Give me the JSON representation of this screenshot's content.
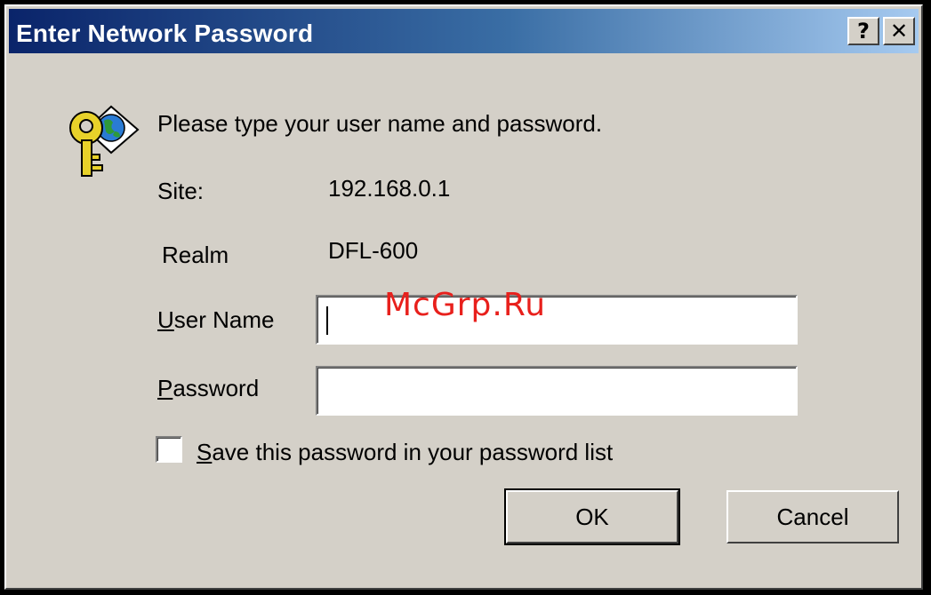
{
  "window": {
    "title": "Enter Network Password",
    "help_glyph": "?",
    "close_glyph": "✕"
  },
  "dialog": {
    "prompt": "Please type your user name and password.",
    "site_label": "Site:",
    "site_value": "192.168.0.1",
    "realm_label": "Realm",
    "realm_value": "DFL-600",
    "user_label_key": "U",
    "user_label_rest": "ser Name",
    "user_value": "",
    "password_label_key": "P",
    "password_label_rest": "assword",
    "password_value": "",
    "save_label_key": "S",
    "save_label_rest": "ave this password in your password list",
    "save_checked": false,
    "ok_label": "OK",
    "cancel_label": "Cancel"
  },
  "watermark": "McGrp.Ru",
  "icons": {
    "dialog_icon": "key-globe-icon"
  },
  "colors": {
    "title_start": "#0a246a",
    "title_end": "#a6caf0",
    "face": "#d4d0c8",
    "watermark": "#e8201c"
  }
}
